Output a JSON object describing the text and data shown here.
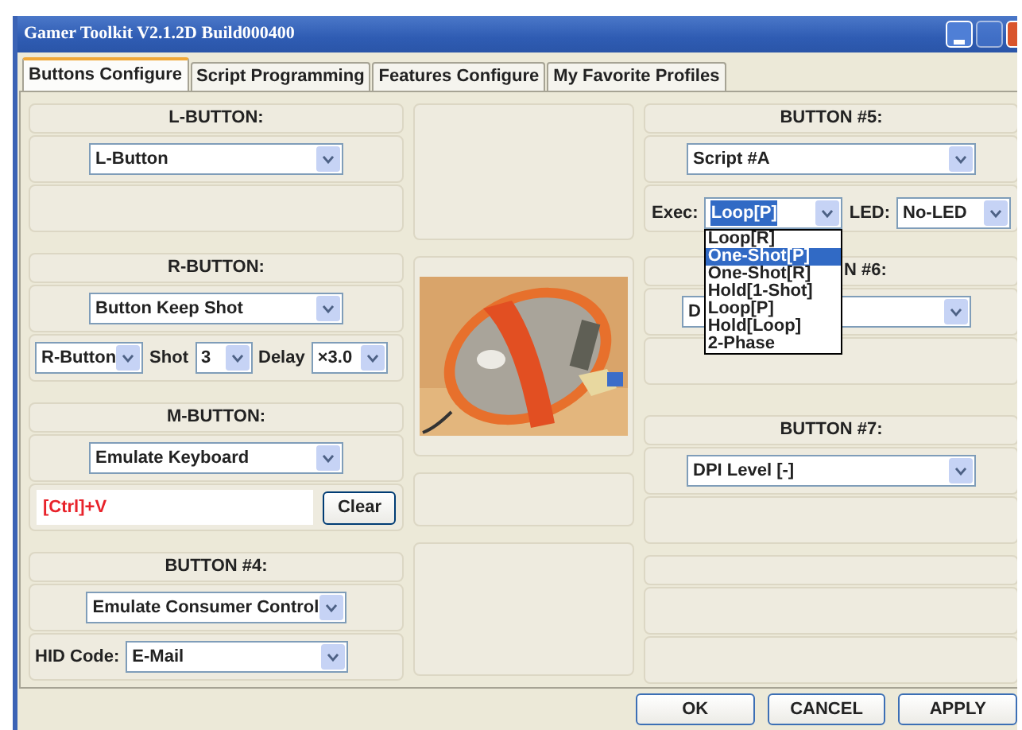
{
  "window": {
    "title": "Gamer Toolkit V2.1.2D Build000400"
  },
  "tabs": [
    {
      "label": "Buttons Configure",
      "selected": true
    },
    {
      "label": "Script Programming",
      "selected": false
    },
    {
      "label": "Features Configure",
      "selected": false
    },
    {
      "label": "My Favorite Profiles",
      "selected": false
    }
  ],
  "left_groups": [
    {
      "title": "L-BUTTON:",
      "action": "L-Button",
      "extra": {
        "kind": "empty"
      }
    },
    {
      "title": "R-BUTTON:",
      "action": "Button Keep Shot",
      "extra": {
        "kind": "controls",
        "items": [
          {
            "kind": "dropdown",
            "text": "R-Button"
          },
          {
            "kind": "label",
            "text": "Shot"
          },
          {
            "kind": "dropdown",
            "text": "3"
          },
          {
            "kind": "label",
            "text": "Delay"
          },
          {
            "kind": "dropdown",
            "text": "×3.0"
          }
        ]
      }
    },
    {
      "title": "M-BUTTON:",
      "action": "Emulate Keyboard",
      "extra": {
        "kind": "keys",
        "value": "[Ctrl]+V",
        "button": "Clear"
      }
    },
    {
      "title": "BUTTON #4:",
      "action": "Emulate Consumer Control",
      "extra": {
        "kind": "controls",
        "items": [
          {
            "kind": "label",
            "text": "HID Code:"
          },
          {
            "kind": "dropdown",
            "text": "E-Mail"
          }
        ]
      }
    }
  ],
  "right_groups": [
    {
      "title": "BUTTON #5:",
      "action": "Script #A",
      "extra": {
        "kind": "exec",
        "items": [
          {
            "kind": "label",
            "text": "Exec:"
          },
          {
            "kind": "dropdown",
            "text": "Loop[P]",
            "highlighted": true,
            "open": true
          },
          {
            "kind": "label",
            "text": "LED:"
          },
          {
            "kind": "dropdown",
            "text": "No-LED"
          }
        ]
      }
    },
    {
      "title": "N #6:",
      "action": "D",
      "extra": {
        "kind": "empty"
      }
    },
    {
      "title": "BUTTON #7:",
      "action": "DPI Level [-]",
      "extra": {
        "kind": "empty"
      }
    },
    {
      "extra": {
        "kind": "empty"
      }
    }
  ],
  "open_list": {
    "options": [
      {
        "label": "Loop[R]",
        "selected": false
      },
      {
        "label": "One-Shot[P]",
        "selected": true
      },
      {
        "label": "One-Shot[R]",
        "selected": false
      },
      {
        "label": "Hold[1-Shot]",
        "selected": false
      },
      {
        "label": "Loop[P]",
        "selected": false
      },
      {
        "label": "Hold[Loop]",
        "selected": false
      },
      {
        "label": "2-Phase",
        "selected": false
      }
    ]
  },
  "buttons": [
    "OK",
    "CANCEL",
    "APPLY"
  ]
}
